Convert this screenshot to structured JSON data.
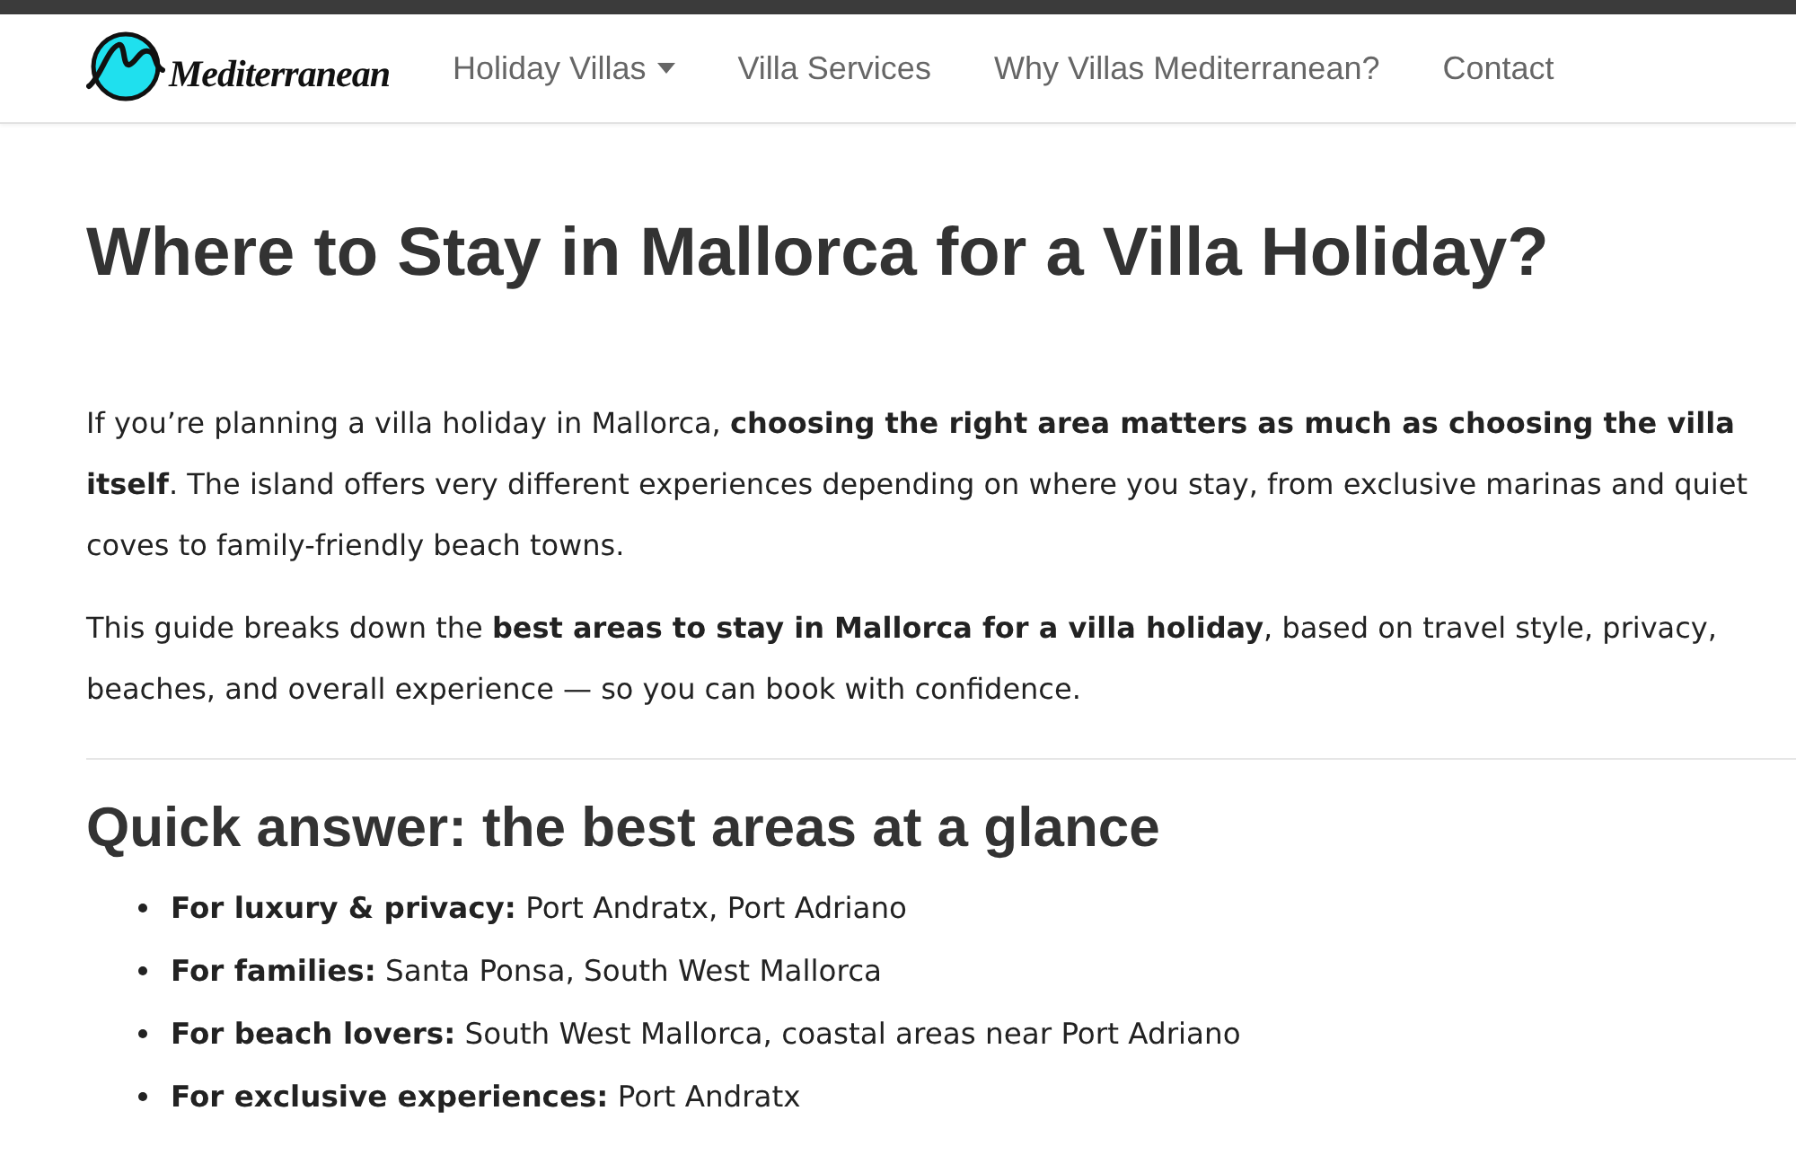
{
  "header": {
    "logo": {
      "text": "Mediterranean"
    },
    "nav": [
      {
        "label": "Holiday Villas",
        "dropdown": true
      },
      {
        "label": "Villa Services",
        "dropdown": false
      },
      {
        "label": "Why Villas Mediterranean?",
        "dropdown": false
      },
      {
        "label": "Contact",
        "dropdown": false
      }
    ]
  },
  "article": {
    "title": "Where to Stay in Mallorca for a Villa Holiday?",
    "paragraphs": [
      "If you’re planning a villa holiday in Mallorca, **choosing the right area matters as much as choosing the villa itself**. The island offers very different experiences depending on where you stay, from exclusive marinas and quiet coves to family-friendly beach towns.",
      "This guide breaks down the **best areas to stay in Mallorca for a villa holiday**, based on travel style, privacy, beaches, and overall experience — so you can book with confidence."
    ],
    "section": {
      "heading": "Quick answer: the best areas at a glance",
      "items": [
        "**For luxury & privacy:** Port Andratx, Port Adriano",
        "**For families:** Santa Ponsa, South West Mallorca",
        "**For beach lovers:** South West Mallorca, coastal areas near Port Adriano",
        "**For exclusive experiences:** Port Andratx"
      ]
    }
  }
}
